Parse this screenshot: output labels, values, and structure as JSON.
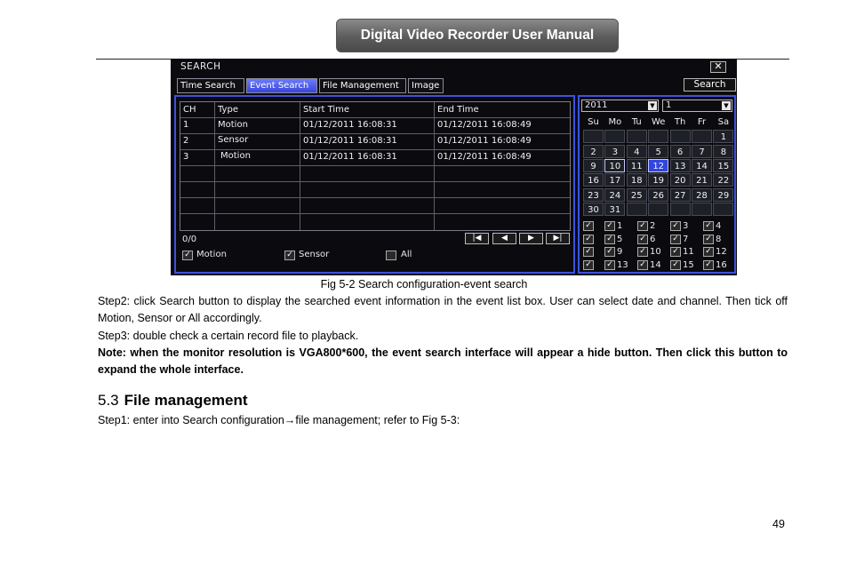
{
  "manual_header": {
    "title": "Digital Video Recorder User Manual"
  },
  "dvr": {
    "title": "SEARCH",
    "close_glyph": "✕",
    "tabs": [
      "Time Search",
      "Event Search",
      "File Management",
      "Image"
    ],
    "active_tab": "Event Search",
    "search_button": "Search",
    "table": {
      "headers": [
        "CH",
        "Type",
        "Start Time",
        "End Time"
      ],
      "rows": [
        [
          "1",
          "Motion",
          "01/12/2011 16:08:31",
          "01/12/2011 16:08:49"
        ],
        [
          "2",
          "Sensor",
          "01/12/2011 16:08:31",
          "01/12/2011 16:08:49"
        ],
        [
          "3",
          "Motion",
          "01/12/2011 16:08:31",
          "01/12/2011 16:08:49"
        ]
      ]
    },
    "pager_count": "0/0",
    "pager_buttons": [
      "first-page",
      "prev-page",
      "next-page",
      "last-page"
    ],
    "filters": [
      {
        "label": "Motion",
        "checked": true
      },
      {
        "label": "Sensor",
        "checked": true
      },
      {
        "label": "All",
        "checked": false
      }
    ],
    "year_select": "2011",
    "month_select": "1",
    "weekdays": [
      "Su",
      "Mo",
      "Tu",
      "We",
      "Th",
      "Fr",
      "Sa"
    ],
    "calendar_weeks": [
      [
        "",
        "",
        "",
        "",
        "",
        "",
        "1"
      ],
      [
        "2",
        "3",
        "4",
        "5",
        "6",
        "7",
        "8"
      ],
      [
        "9",
        "10",
        "11",
        "12",
        "13",
        "14",
        "15"
      ],
      [
        "16",
        "17",
        "18",
        "19",
        "20",
        "21",
        "22"
      ],
      [
        "23",
        "24",
        "25",
        "26",
        "27",
        "28",
        "29"
      ],
      [
        "30",
        "31",
        "",
        "",
        "",
        "",
        ""
      ]
    ],
    "highlighted_day": "12",
    "boxed_day": "10",
    "channels": [
      "",
      "1",
      "2",
      "3",
      "4",
      "",
      "5",
      "6",
      "7",
      "8",
      "",
      "9",
      "10",
      "11",
      "12",
      "",
      "13",
      "14",
      "15",
      "16"
    ],
    "colors": {
      "accent_blue": "#3d52e0",
      "highlight": "#3146e0",
      "background": "#0b0b0f"
    }
  },
  "caption": "Fig 5-2 Search configuration-event search",
  "step2": "Step2: click Search button to display the searched event information in the event list box. User can select date and channel. Then tick off Motion, Sensor or All accordingly.",
  "step3": "Step3: double check a certain record file to playback.",
  "note": "Note: when the monitor resolution is VGA800*600, the event search interface will appear a hide button. Then click this button to expand the whole interface.",
  "section": {
    "number": "5.3",
    "title": "File management"
  },
  "step1": "Step1: enter into Search configuration→file management; refer to Fig 5-3:",
  "page_number": "49"
}
